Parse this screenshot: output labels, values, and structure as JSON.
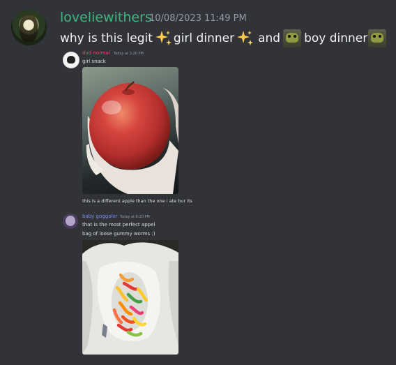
{
  "message": {
    "username": "loveliewithers",
    "timestamp": "10/08/2023 11:49 PM",
    "parts": [
      "why is this legit",
      "girl dinner",
      "and",
      "boy dinner"
    ],
    "emojis": [
      "sparkles-icon",
      "frog-emoji-icon"
    ]
  },
  "embedded_chat": {
    "messages": [
      {
        "author": "dvd normal",
        "time": "Today at 3:20 PM",
        "author_color": "#f04770",
        "lines": [
          "girl snack"
        ],
        "image_caption": "this is a different apple than the one i ate bur its"
      },
      {
        "author": "baby goggalor",
        "time": "Today at 6:20 PM",
        "author_color": "#7c8cf8",
        "lines": [
          "that is the most perfect appel",
          "bag of loose gummy worms :)"
        ]
      }
    ]
  },
  "colors": {
    "background": "#313338",
    "username": "#43b581",
    "timestamp": "#949ba4",
    "text": "#f2f3f5"
  }
}
